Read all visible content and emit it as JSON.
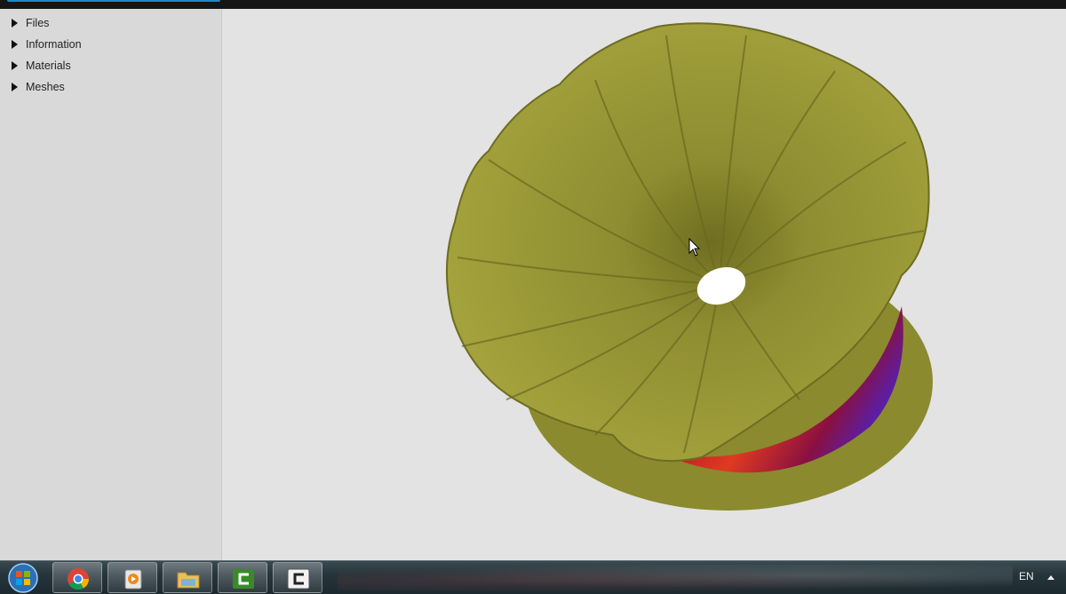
{
  "sidebar": {
    "items": [
      {
        "label": "Files"
      },
      {
        "label": "Information"
      },
      {
        "label": "Materials"
      },
      {
        "label": "Meshes"
      }
    ]
  },
  "viewport": {
    "model_color": "#8e8d31",
    "band_colors": [
      "#b0122a",
      "#5a1ea8"
    ]
  },
  "taskbar": {
    "apps": [
      "chrome-icon",
      "media-player-icon",
      "file-explorer-icon",
      "camtasia-icon",
      "camtasia-recorder-icon"
    ],
    "tray": {
      "language": "EN"
    }
  }
}
